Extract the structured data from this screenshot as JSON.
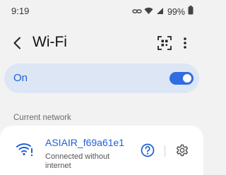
{
  "status_bar": {
    "time": "9:19",
    "battery": "99%"
  },
  "app_bar": {
    "title": "Wi-Fi",
    "icons": [
      "back-arrow-icon",
      "qr-scan-icon",
      "more-vert-icon"
    ]
  },
  "wifi_toggle": {
    "label": "On",
    "state": "on",
    "accent": "#2f6de0"
  },
  "current_network": {
    "section_title": "Current network",
    "name": "ASIAIR_f69a61e1",
    "status": "Connected without internet",
    "icons": [
      "wifi-alert-icon",
      "help-icon",
      "settings-gear-icon"
    ]
  }
}
